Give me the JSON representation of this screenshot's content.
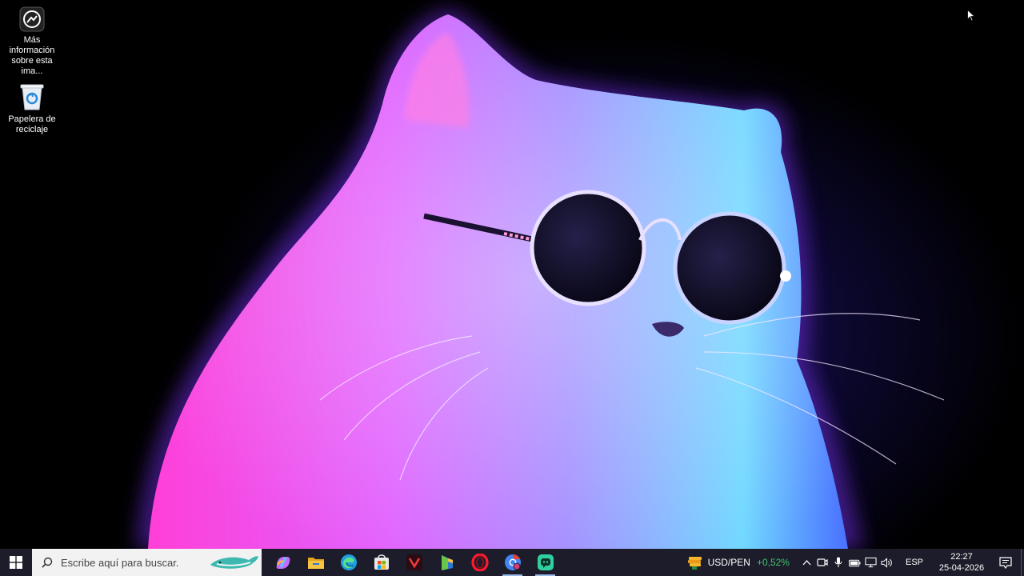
{
  "desktop": {
    "icons": [
      {
        "label": "Más información sobre esta ima...",
        "icon": "spotlight-info-icon"
      },
      {
        "label": "Papelera de reciclaje",
        "icon": "recycle-bin-icon"
      }
    ],
    "wallpaper": "neon-cat-with-sunglasses"
  },
  "taskbar": {
    "start_icon": "windows-start-icon",
    "search_placeholder": "Escribe aquí para buscar.",
    "apps": [
      {
        "name": "copilot",
        "icon": "copilot-icon",
        "color": "#c56bff"
      },
      {
        "name": "file-explorer",
        "icon": "folder-icon",
        "color": "#f5c542"
      },
      {
        "name": "edge",
        "icon": "edge-icon",
        "color": "#1fa0e0"
      },
      {
        "name": "store",
        "icon": "store-icon",
        "color": "#e8e8e8"
      },
      {
        "name": "vivaldi",
        "icon": "vivaldi-icon",
        "color": "#ef3939"
      },
      {
        "name": "bluestacks",
        "icon": "bluestacks-icon",
        "color": "#6ac64a"
      },
      {
        "name": "opera",
        "icon": "opera-icon",
        "color": "#ff1b2d"
      },
      {
        "name": "chrome-profile",
        "icon": "chrome-icon",
        "color": "#4285f4"
      },
      {
        "name": "discord-like",
        "icon": "chat-app-icon",
        "color": "#2fd0a0"
      }
    ],
    "ticker": {
      "symbol": "USD/PEN",
      "change": "+0,52%",
      "change_color": "#3ec46d"
    },
    "tray_icons": [
      "chevron-up-icon",
      "meet-now-icon",
      "microphone-icon",
      "battery-icon",
      "network-icon",
      "volume-icon"
    ],
    "language": "ESP",
    "time": "22:27",
    "date": "25-04-2026"
  }
}
